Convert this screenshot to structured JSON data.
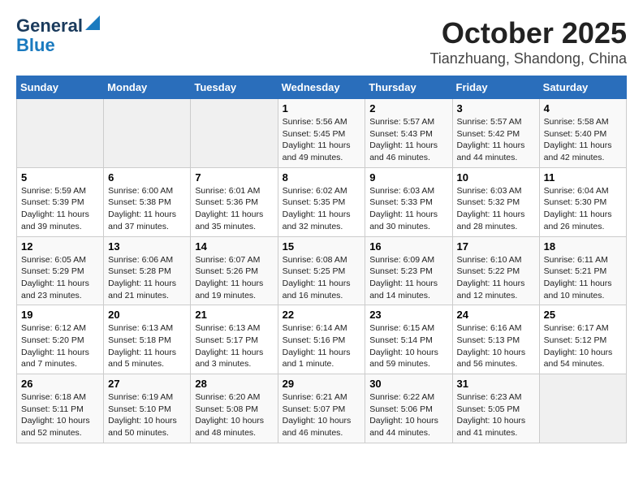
{
  "logo": {
    "line1": "General",
    "line2": "Blue"
  },
  "title": "October 2025",
  "location": "Tianzhuang, Shandong, China",
  "weekdays": [
    "Sunday",
    "Monday",
    "Tuesday",
    "Wednesday",
    "Thursday",
    "Friday",
    "Saturday"
  ],
  "weeks": [
    [
      {
        "day": "",
        "info": ""
      },
      {
        "day": "",
        "info": ""
      },
      {
        "day": "",
        "info": ""
      },
      {
        "day": "1",
        "info": "Sunrise: 5:56 AM\nSunset: 5:45 PM\nDaylight: 11 hours\nand 49 minutes."
      },
      {
        "day": "2",
        "info": "Sunrise: 5:57 AM\nSunset: 5:43 PM\nDaylight: 11 hours\nand 46 minutes."
      },
      {
        "day": "3",
        "info": "Sunrise: 5:57 AM\nSunset: 5:42 PM\nDaylight: 11 hours\nand 44 minutes."
      },
      {
        "day": "4",
        "info": "Sunrise: 5:58 AM\nSunset: 5:40 PM\nDaylight: 11 hours\nand 42 minutes."
      }
    ],
    [
      {
        "day": "5",
        "info": "Sunrise: 5:59 AM\nSunset: 5:39 PM\nDaylight: 11 hours\nand 39 minutes."
      },
      {
        "day": "6",
        "info": "Sunrise: 6:00 AM\nSunset: 5:38 PM\nDaylight: 11 hours\nand 37 minutes."
      },
      {
        "day": "7",
        "info": "Sunrise: 6:01 AM\nSunset: 5:36 PM\nDaylight: 11 hours\nand 35 minutes."
      },
      {
        "day": "8",
        "info": "Sunrise: 6:02 AM\nSunset: 5:35 PM\nDaylight: 11 hours\nand 32 minutes."
      },
      {
        "day": "9",
        "info": "Sunrise: 6:03 AM\nSunset: 5:33 PM\nDaylight: 11 hours\nand 30 minutes."
      },
      {
        "day": "10",
        "info": "Sunrise: 6:03 AM\nSunset: 5:32 PM\nDaylight: 11 hours\nand 28 minutes."
      },
      {
        "day": "11",
        "info": "Sunrise: 6:04 AM\nSunset: 5:30 PM\nDaylight: 11 hours\nand 26 minutes."
      }
    ],
    [
      {
        "day": "12",
        "info": "Sunrise: 6:05 AM\nSunset: 5:29 PM\nDaylight: 11 hours\nand 23 minutes."
      },
      {
        "day": "13",
        "info": "Sunrise: 6:06 AM\nSunset: 5:28 PM\nDaylight: 11 hours\nand 21 minutes."
      },
      {
        "day": "14",
        "info": "Sunrise: 6:07 AM\nSunset: 5:26 PM\nDaylight: 11 hours\nand 19 minutes."
      },
      {
        "day": "15",
        "info": "Sunrise: 6:08 AM\nSunset: 5:25 PM\nDaylight: 11 hours\nand 16 minutes."
      },
      {
        "day": "16",
        "info": "Sunrise: 6:09 AM\nSunset: 5:23 PM\nDaylight: 11 hours\nand 14 minutes."
      },
      {
        "day": "17",
        "info": "Sunrise: 6:10 AM\nSunset: 5:22 PM\nDaylight: 11 hours\nand 12 minutes."
      },
      {
        "day": "18",
        "info": "Sunrise: 6:11 AM\nSunset: 5:21 PM\nDaylight: 11 hours\nand 10 minutes."
      }
    ],
    [
      {
        "day": "19",
        "info": "Sunrise: 6:12 AM\nSunset: 5:20 PM\nDaylight: 11 hours\nand 7 minutes."
      },
      {
        "day": "20",
        "info": "Sunrise: 6:13 AM\nSunset: 5:18 PM\nDaylight: 11 hours\nand 5 minutes."
      },
      {
        "day": "21",
        "info": "Sunrise: 6:13 AM\nSunset: 5:17 PM\nDaylight: 11 hours\nand 3 minutes."
      },
      {
        "day": "22",
        "info": "Sunrise: 6:14 AM\nSunset: 5:16 PM\nDaylight: 11 hours\nand 1 minute."
      },
      {
        "day": "23",
        "info": "Sunrise: 6:15 AM\nSunset: 5:14 PM\nDaylight: 10 hours\nand 59 minutes."
      },
      {
        "day": "24",
        "info": "Sunrise: 6:16 AM\nSunset: 5:13 PM\nDaylight: 10 hours\nand 56 minutes."
      },
      {
        "day": "25",
        "info": "Sunrise: 6:17 AM\nSunset: 5:12 PM\nDaylight: 10 hours\nand 54 minutes."
      }
    ],
    [
      {
        "day": "26",
        "info": "Sunrise: 6:18 AM\nSunset: 5:11 PM\nDaylight: 10 hours\nand 52 minutes."
      },
      {
        "day": "27",
        "info": "Sunrise: 6:19 AM\nSunset: 5:10 PM\nDaylight: 10 hours\nand 50 minutes."
      },
      {
        "day": "28",
        "info": "Sunrise: 6:20 AM\nSunset: 5:08 PM\nDaylight: 10 hours\nand 48 minutes."
      },
      {
        "day": "29",
        "info": "Sunrise: 6:21 AM\nSunset: 5:07 PM\nDaylight: 10 hours\nand 46 minutes."
      },
      {
        "day": "30",
        "info": "Sunrise: 6:22 AM\nSunset: 5:06 PM\nDaylight: 10 hours\nand 44 minutes."
      },
      {
        "day": "31",
        "info": "Sunrise: 6:23 AM\nSunset: 5:05 PM\nDaylight: 10 hours\nand 41 minutes."
      },
      {
        "day": "",
        "info": ""
      }
    ]
  ]
}
